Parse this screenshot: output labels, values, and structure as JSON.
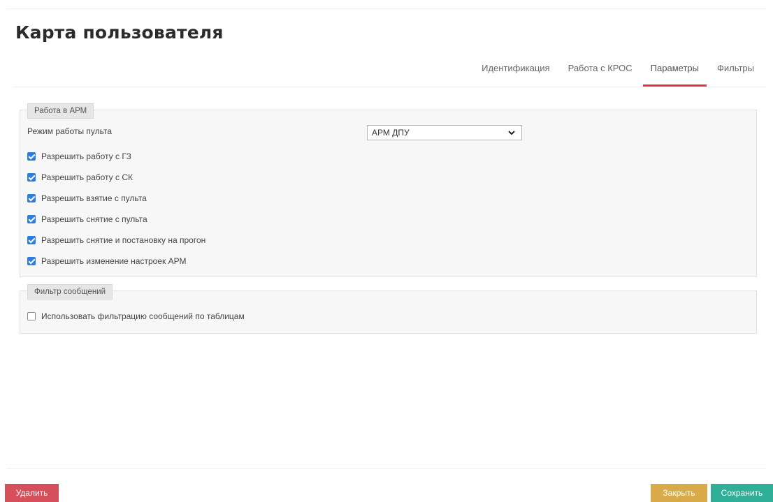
{
  "page": {
    "title": "Карта пользователя"
  },
  "tabs": [
    {
      "label": "Идентификация",
      "active": false
    },
    {
      "label": "Работа с КРОС",
      "active": false
    },
    {
      "label": "Параметры",
      "active": true
    },
    {
      "label": "Фильтры",
      "active": false
    }
  ],
  "arm_group": {
    "legend": "Работа в АРМ",
    "mode_label": "Режим работы пульта",
    "mode_value": "АРМ ДПУ",
    "options": [
      {
        "label": "Разрешить работу с ГЗ",
        "checked": true
      },
      {
        "label": "Разрешить работу с СК",
        "checked": true
      },
      {
        "label": "Разрешить взятие с пульта",
        "checked": true
      },
      {
        "label": "Разрешить снятие с пульта",
        "checked": true
      },
      {
        "label": "Разрешить снятие и постановку на прогон",
        "checked": true
      },
      {
        "label": "Разрешить изменение настроек АРМ",
        "checked": true
      }
    ]
  },
  "filter_group": {
    "legend": "Фильтр сообщений",
    "option": {
      "label": "Использовать фильтрацию сообщений по таблицам",
      "checked": false
    }
  },
  "footer": {
    "delete_label": "Удалить",
    "close_label": "Закрыть",
    "save_label": "Сохранить"
  },
  "colors": {
    "tab_active_underline": "#e03546",
    "checkbox": "#2d7de0",
    "delete": "#d5505a",
    "close": "#d9aa4a",
    "save": "#2fae98"
  }
}
